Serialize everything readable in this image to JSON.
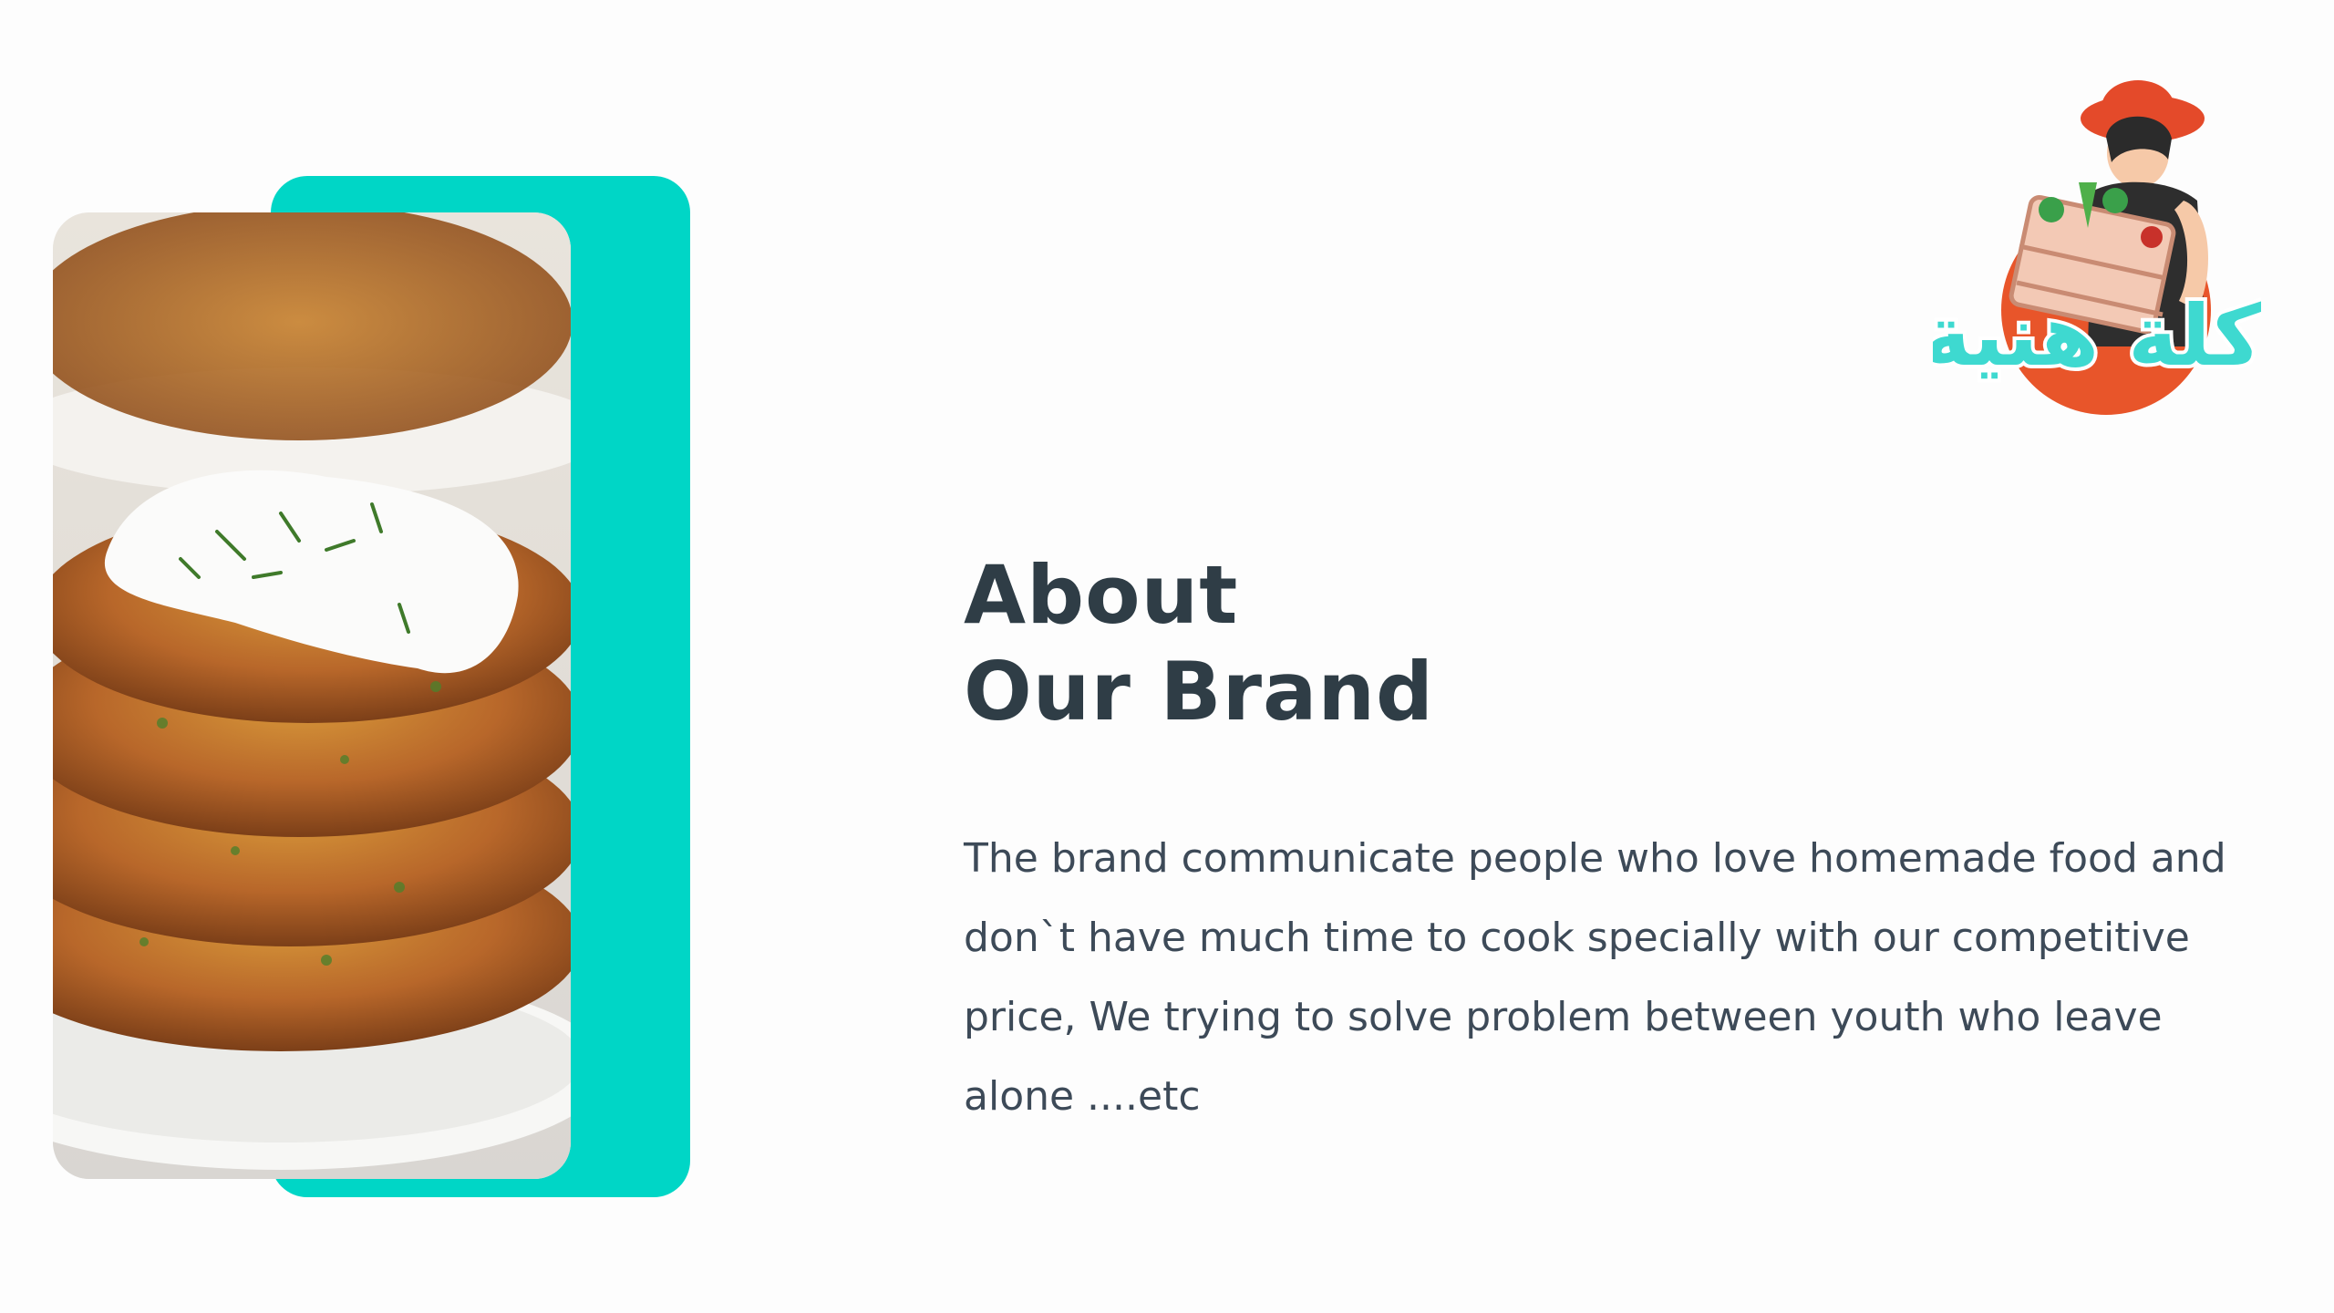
{
  "slide": {
    "heading_line1": "About",
    "heading_line2": "Our Brand",
    "body": "The brand communicate people who love homemade food and don`t have much time to cook specially with our competitive price, We trying to solve problem between youth who leave alone ....etc"
  },
  "logo": {
    "arabic_text": "أكلة هنية"
  },
  "colors": {
    "accent_teal": "#00d6c6",
    "text_dark": "#2f3d46",
    "logo_orange": "#e8552a"
  },
  "icons": {
    "photo": "fritters-photo",
    "logo": "brand-logo-vendor"
  }
}
